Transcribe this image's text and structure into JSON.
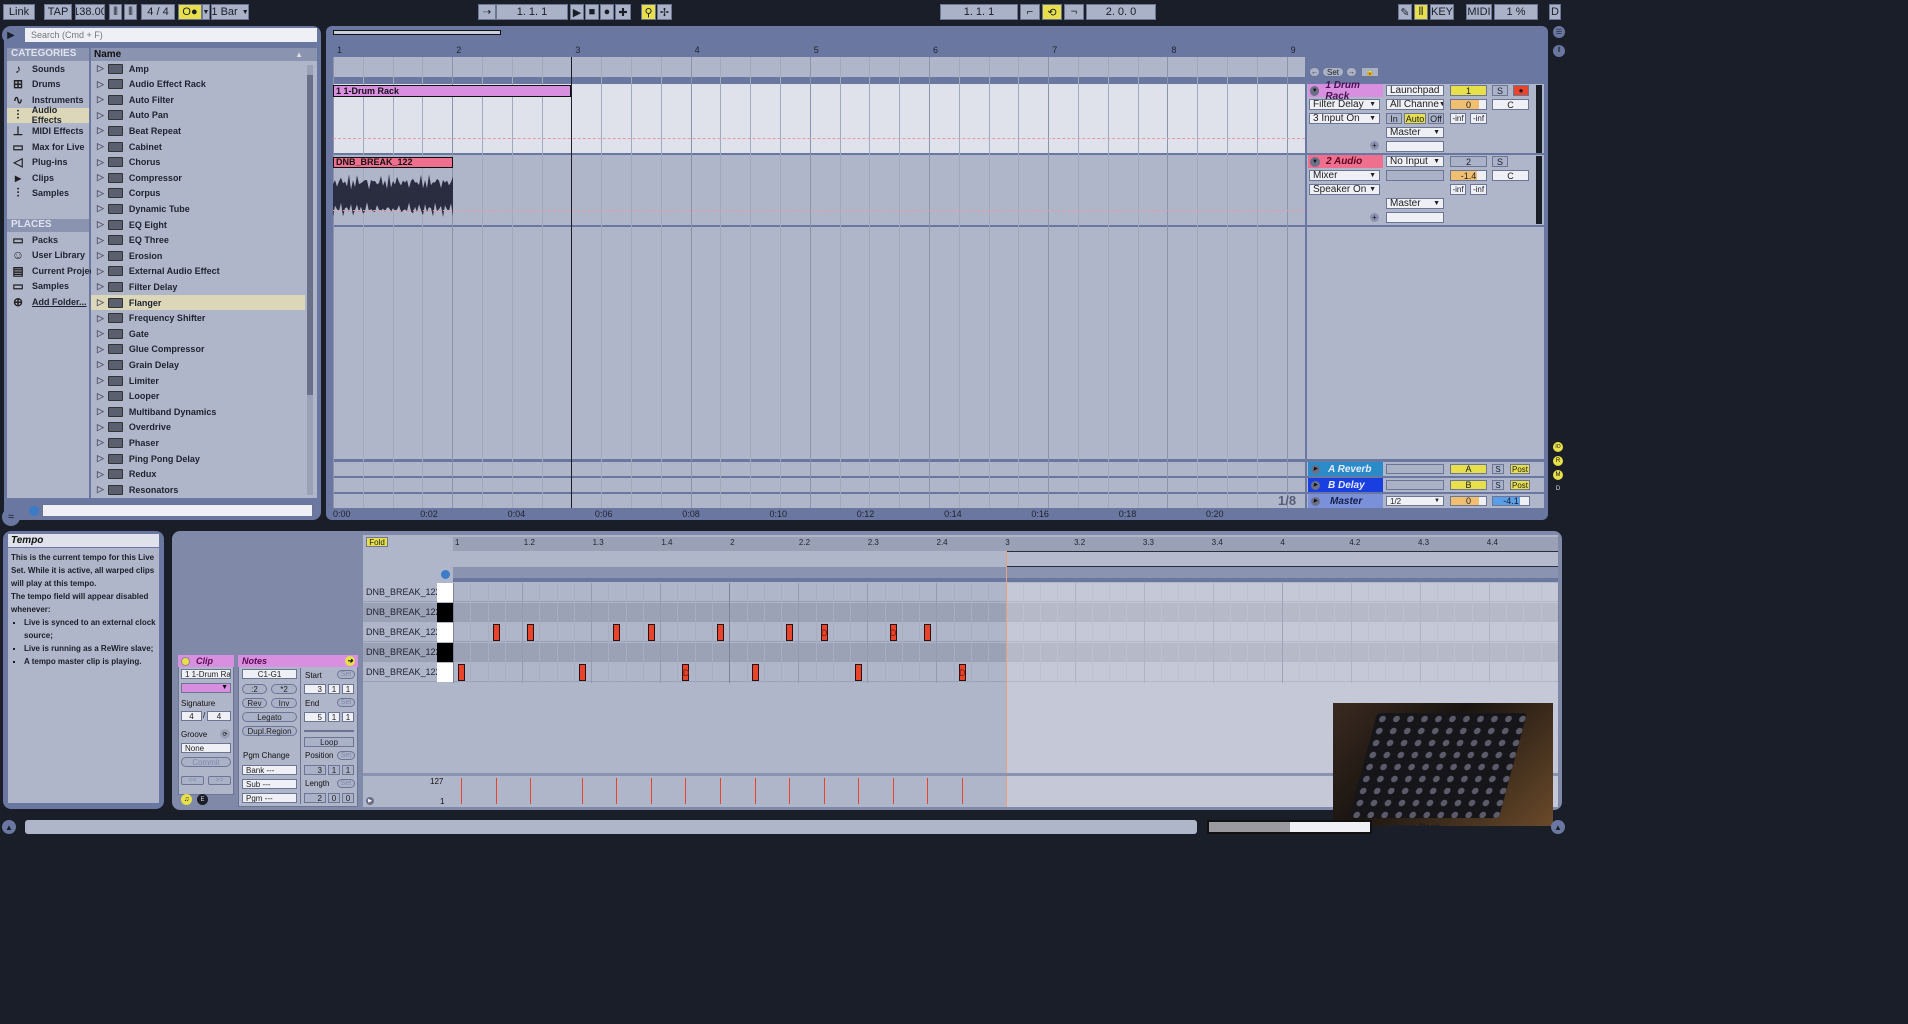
{
  "transport": {
    "link": "Link",
    "tap": "TAP",
    "tempo": "138.00",
    "time_sig": "4  /  4",
    "metronome": "O●",
    "quantize": "1 Bar",
    "song_position": "1.   1.   1",
    "loop_start": "1.   1.   1",
    "loop_length": "2.   0.   0",
    "key": "KEY",
    "midi": "MIDI",
    "cpu": "1 %",
    "d": "D"
  },
  "browser": {
    "search_placeholder": "Search (Cmd + F)",
    "categories_header": "CATEGORIES",
    "categories": [
      {
        "label": "Sounds",
        "icon": "♪"
      },
      {
        "label": "Drums",
        "icon": "⊞"
      },
      {
        "label": "Instruments",
        "icon": "∿"
      },
      {
        "label": "Audio Effects",
        "icon": "⫶"
      },
      {
        "label": "MIDI Effects",
        "icon": "⊥"
      },
      {
        "label": "Max for Live",
        "icon": "▭"
      },
      {
        "label": "Plug-ins",
        "icon": "◁"
      },
      {
        "label": "Clips",
        "icon": "▸"
      },
      {
        "label": "Samples",
        "icon": "⫶"
      }
    ],
    "selected_category": "Audio Effects",
    "places_header": "PLACES",
    "places": [
      {
        "label": "Packs",
        "icon": "▭"
      },
      {
        "label": "User Library",
        "icon": "☺"
      },
      {
        "label": "Current Project",
        "icon": "▤"
      },
      {
        "label": "Samples",
        "icon": "▭"
      },
      {
        "label": "Add Folder...",
        "icon": "⊕"
      }
    ],
    "name_header": "Name",
    "items": [
      "Amp",
      "Audio Effect Rack",
      "Auto Filter",
      "Auto Pan",
      "Beat Repeat",
      "Cabinet",
      "Chorus",
      "Compressor",
      "Corpus",
      "Dynamic Tube",
      "EQ Eight",
      "EQ Three",
      "Erosion",
      "External Audio Effect",
      "Filter Delay",
      "Flanger",
      "Frequency Shifter",
      "Gate",
      "Glue Compressor",
      "Grain Delay",
      "Limiter",
      "Looper",
      "Multiband Dynamics",
      "Overdrive",
      "Phaser",
      "Ping Pong Delay",
      "Redux",
      "Resonators"
    ],
    "selected_item": "Flanger"
  },
  "arrangement": {
    "bar_ruler": [
      "1",
      "2",
      "3",
      "4",
      "5",
      "6",
      "7",
      "8",
      "9"
    ],
    "time_ruler": [
      "0:00",
      "0:02",
      "0:04",
      "0:06",
      "0:08",
      "0:10",
      "0:12",
      "0:14",
      "0:16",
      "0:18",
      "0:20"
    ],
    "clips": [
      {
        "name": "1 1-Drum Rack",
        "color": "#d98fe0"
      },
      {
        "name": "DNB_BREAK_122",
        "color": "#ef6f8e"
      }
    ],
    "zoom_label": "1/8",
    "set_label": "Set"
  },
  "mixer": {
    "tracks": [
      {
        "name": "1 Drum Rack",
        "color": "#d98fe0",
        "device": "Filter Delay",
        "input_status": "3 Input On",
        "input": "Launchpad F",
        "channel": "All Channe",
        "monitor": [
          "In",
          "Auto",
          "Off"
        ],
        "monitor_active": "Auto",
        "output": "Master",
        "number": "1",
        "solo": "S",
        "volume": "0",
        "pan": "C",
        "peak_l": "-inf",
        "peak_r": "-inf"
      },
      {
        "name": "2 Audio",
        "color": "#ef6f8e",
        "device": "Mixer",
        "input_status": "Speaker On",
        "input": "No Input",
        "output": "Master",
        "number": "2",
        "solo": "S",
        "volume": "-1.4",
        "pan": "C",
        "peak_l": "-inf",
        "peak_r": "-inf"
      }
    ],
    "returns": [
      {
        "name": "A Reverb",
        "color": "#2a8bc8",
        "letter": "A",
        "solo": "S",
        "post": "Post"
      },
      {
        "name": "B Delay",
        "color": "#1a3fe0",
        "letter": "B",
        "solo": "S",
        "post": "Post"
      }
    ],
    "master": {
      "name": "Master",
      "output": "1/2",
      "volume": "0",
      "meter": "-4.1"
    }
  },
  "info": {
    "title": "Tempo",
    "body": [
      "This is the current tempo for this Live Set. While it is active, all warped clips will play at this tempo.",
      "The tempo field will appear disabled whenever:"
    ],
    "bullets": [
      "Live is synced to an external clock source;",
      "Live is running as a ReWire slave;",
      "A tempo master clip is playing."
    ]
  },
  "clip": {
    "header": "Clip",
    "name": "1 1-Drum Ra",
    "signature_label": "Signature",
    "sig_num": "4",
    "sig_den": "4",
    "groove_label": "Groove",
    "groove": "None",
    "commit": "Commit",
    "prev": "<<",
    "next": ">>"
  },
  "notes": {
    "header": "Notes",
    "range": "C1-G1",
    "half": ":2",
    "double": "*2",
    "rev": "Rev",
    "inv": "Inv",
    "legato": "Legato",
    "dupl": "Dupl.Region",
    "pgm_change": "Pgm Change",
    "bank": "Bank ---",
    "sub": "Sub ---",
    "pgm": "Pgm ---",
    "start_label": "Start",
    "start": [
      "3",
      "1",
      "1"
    ],
    "end_label": "End",
    "end": [
      "5",
      "1",
      "1"
    ],
    "loop": "Loop",
    "position_label": "Position",
    "position": [
      "3",
      "1",
      "1"
    ],
    "length_label": "Length",
    "length": [
      "2",
      "0",
      "0"
    ],
    "set": "Set"
  },
  "piano_roll": {
    "fold": "Fold",
    "ruler": [
      "1",
      "1.2",
      "1.3",
      "1.4",
      "2",
      "2.2",
      "2.3",
      "2.4",
      "3",
      "3.2",
      "3.3",
      "3.4",
      "4",
      "4.2",
      "4.3",
      "4.4"
    ],
    "rows": [
      "DNB_BREAK_122",
      "DNB_BREAK_122",
      "DNB_BREAK_122",
      "DNB_BREAK_122",
      "DNB_BREAK_122"
    ],
    "velocity_max": "127",
    "velocity_min": "1",
    "notes": [
      {
        "row": 2,
        "beat": 0.5,
        "deact": false
      },
      {
        "row": 2,
        "beat": 1.0,
        "deact": false
      },
      {
        "row": 2,
        "beat": 2.25,
        "deact": false
      },
      {
        "row": 2,
        "beat": 2.75,
        "deact": false
      },
      {
        "row": 2,
        "beat": 3.75,
        "deact": false
      },
      {
        "row": 2,
        "beat": 4.75,
        "deact": false
      },
      {
        "row": 2,
        "beat": 5.25,
        "deact": true
      },
      {
        "row": 2,
        "beat": 6.25,
        "deact": true
      },
      {
        "row": 2,
        "beat": 6.75,
        "deact": false
      },
      {
        "row": 4,
        "beat": 0.0,
        "deact": false
      },
      {
        "row": 4,
        "beat": 1.75,
        "deact": false
      },
      {
        "row": 4,
        "beat": 3.25,
        "deact": true
      },
      {
        "row": 4,
        "beat": 4.25,
        "deact": false
      },
      {
        "row": 4,
        "beat": 5.75,
        "deact": false
      },
      {
        "row": 4,
        "beat": 7.25,
        "deact": true
      }
    ]
  },
  "status": {
    "track_name": "1-Drum Rack"
  }
}
